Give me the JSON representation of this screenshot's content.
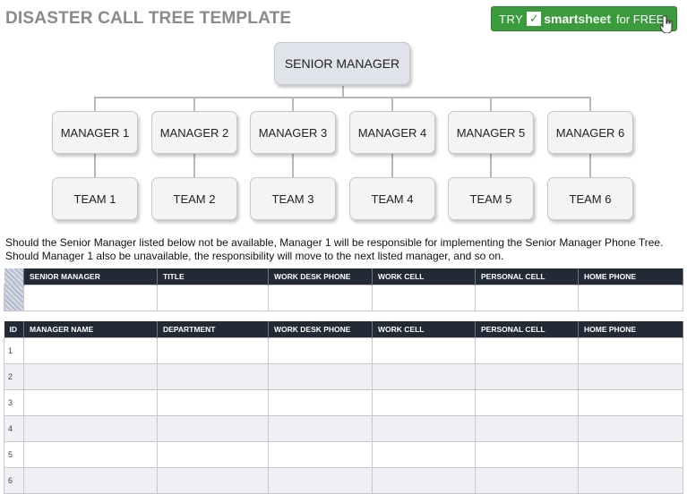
{
  "header": {
    "title": "DISASTER CALL TREE TEMPLATE"
  },
  "promo": {
    "try": "TRY",
    "brand_a": "smart",
    "brand_b": "sheet",
    "suffix": "for FREE"
  },
  "tree": {
    "senior": "SENIOR MANAGER",
    "managers": [
      "MANAGER 1",
      "MANAGER 2",
      "MANAGER 3",
      "MANAGER 4",
      "MANAGER 5",
      "MANAGER 6"
    ],
    "teams": [
      "TEAM 1",
      "TEAM 2",
      "TEAM 3",
      "TEAM 4",
      "TEAM 5",
      "TEAM 6"
    ]
  },
  "note": {
    "line1": "Should the Senior Manager listed below not be available, Manager 1 will be responsible for implementing the Senior Manager Phone Tree.",
    "line2": "Should Manager 1 also be unavailable, the responsibility will move to the next listed manager, and so on."
  },
  "senior_table": {
    "headers": [
      "",
      "SENIOR MANAGER",
      "TITLE",
      "WORK DESK PHONE",
      "WORK CELL",
      "PERSONAL CELL",
      "HOME PHONE"
    ]
  },
  "manager_table": {
    "headers": [
      "ID",
      "MANAGER NAME",
      "DEPARTMENT",
      "WORK DESK PHONE",
      "WORK CELL",
      "PERSONAL CELL",
      "HOME PHONE"
    ],
    "ids": [
      "1",
      "2",
      "3",
      "4",
      "5",
      "6"
    ]
  }
}
